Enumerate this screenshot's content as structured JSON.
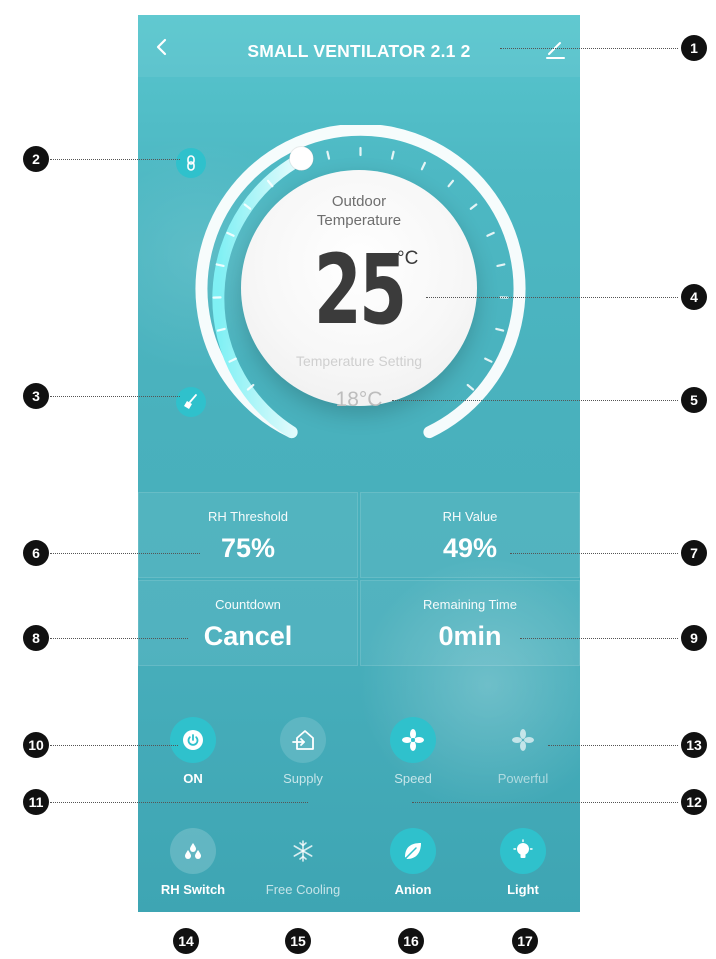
{
  "header": {
    "title": "SMALL VENTILATOR  2.1  2"
  },
  "dial": {
    "outdoor_label": "Outdoor Temperature",
    "temperature": "25",
    "unit": "°C",
    "setting_label": "Temperature Setting",
    "setting_value": "18°C"
  },
  "stats": {
    "rh_threshold_label": "RH Threshold",
    "rh_threshold_value": "75%",
    "rh_value_label": "RH Value",
    "rh_value": "49%",
    "countdown_label": "Countdown",
    "countdown_value": "Cancel",
    "remaining_label": "Remaining Time",
    "remaining_value": "0min"
  },
  "buttons_row1": [
    {
      "label": "ON",
      "icon": "power-icon"
    },
    {
      "label": "Supply",
      "icon": "supply-house-icon"
    },
    {
      "label": "Speed",
      "icon": "fan-icon"
    },
    {
      "label": "Powerful",
      "icon": "fan-icon"
    }
  ],
  "buttons_row2": [
    {
      "label": "RH Switch",
      "icon": "water-drops-icon"
    },
    {
      "label": "Free Cooling",
      "icon": "snowflake-icon"
    },
    {
      "label": "Anion",
      "icon": "leaf-icon"
    },
    {
      "label": "Light",
      "icon": "bulb-icon"
    }
  ],
  "callouts": [
    "1",
    "2",
    "3",
    "4",
    "5",
    "6",
    "7",
    "8",
    "9",
    "10",
    "11",
    "12",
    "13",
    "14",
    "15",
    "16",
    "17"
  ],
  "colors": {
    "accent": "#2fc1cc",
    "background": "#49b1bd",
    "badge": "#111111"
  }
}
